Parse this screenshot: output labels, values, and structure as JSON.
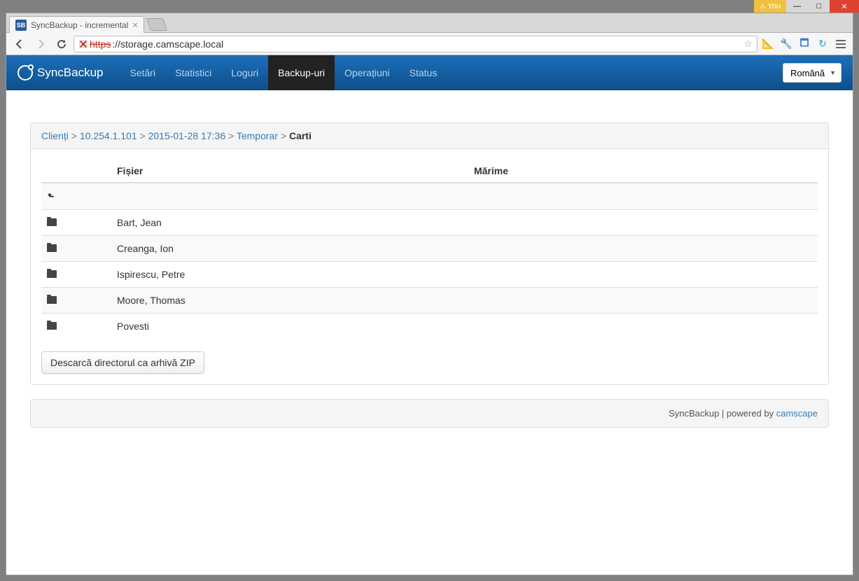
{
  "titlebar": {
    "you": "You"
  },
  "tab": {
    "title": "SyncBackup - incremental"
  },
  "address": {
    "protocol": "https",
    "host": "://storage.camscape.local"
  },
  "brand": "SyncBackup",
  "nav": {
    "items": [
      "Setări",
      "Statistici",
      "Loguri",
      "Backup-uri",
      "Operațiuni",
      "Status"
    ],
    "active_index": 3
  },
  "language": "Română",
  "breadcrumb": {
    "items": [
      "Clienți",
      "10.254.1.101",
      "2015-01-28 17:36",
      "Temporar",
      "Carti"
    ]
  },
  "table": {
    "headers": {
      "file": "Fișier",
      "size": "Mărime"
    },
    "rows": [
      {
        "name": "Bart, Jean",
        "size": ""
      },
      {
        "name": "Creanga, Ion",
        "size": ""
      },
      {
        "name": "Ispirescu, Petre",
        "size": ""
      },
      {
        "name": "Moore, Thomas",
        "size": ""
      },
      {
        "name": "Povesti",
        "size": ""
      }
    ]
  },
  "download_label": "Descarcă directorul ca arhivă ZIP",
  "footer": {
    "prefix": "SyncBackup | powered by ",
    "link": "camscape"
  }
}
